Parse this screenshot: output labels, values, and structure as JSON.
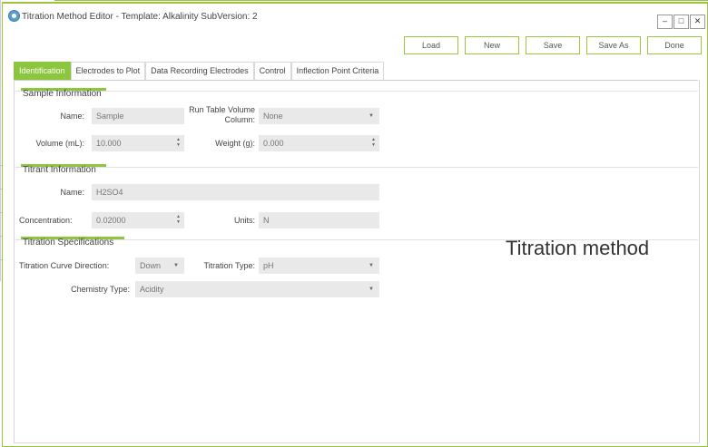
{
  "window": {
    "title": "Titration Method Editor - Template: Alkalinity SubVersion: 2",
    "controls": [
      "–",
      "□",
      "✕"
    ]
  },
  "toolbar": {
    "load": "Load",
    "new": "New",
    "save": "Save",
    "save_as": "Save As",
    "done": "Done"
  },
  "tabs": [
    {
      "label": "Identification",
      "active": true
    },
    {
      "label": "Electrodes to Plot",
      "active": false
    },
    {
      "label": "Data Recording Electrodes",
      "active": false
    },
    {
      "label": "Control",
      "active": false
    },
    {
      "label": "Inflection Point Criteria",
      "active": false
    }
  ],
  "sample": {
    "title": "Sample Information",
    "name_label": "Name:",
    "name_value": "Sample",
    "run_table_label": "Run Table Volume Column:",
    "run_table_value": "None",
    "volume_label": "Volume (mL):",
    "volume_value": "10.000",
    "weight_label": "Weight (g):",
    "weight_value": "0.000"
  },
  "titrant": {
    "title": "Titrant Information",
    "name_label": "Name:",
    "name_value": "H2SO4",
    "concentration_label": "Concentration:",
    "concentration_value": "0.02000",
    "units_label": "Units:",
    "units_value": "N"
  },
  "specs": {
    "title": "Titration Specifications",
    "direction_label": "Titration Curve Direction:",
    "direction_value": "Down",
    "type_label": "Titration Type:",
    "type_value": "pH",
    "chemistry_label": "Chemistry Type:",
    "chemistry_value": "Acidity"
  },
  "overlay": {
    "caption": "Titration method"
  },
  "colors": {
    "accent": "#8cc63f",
    "field_bg": "#e9e9e9"
  }
}
